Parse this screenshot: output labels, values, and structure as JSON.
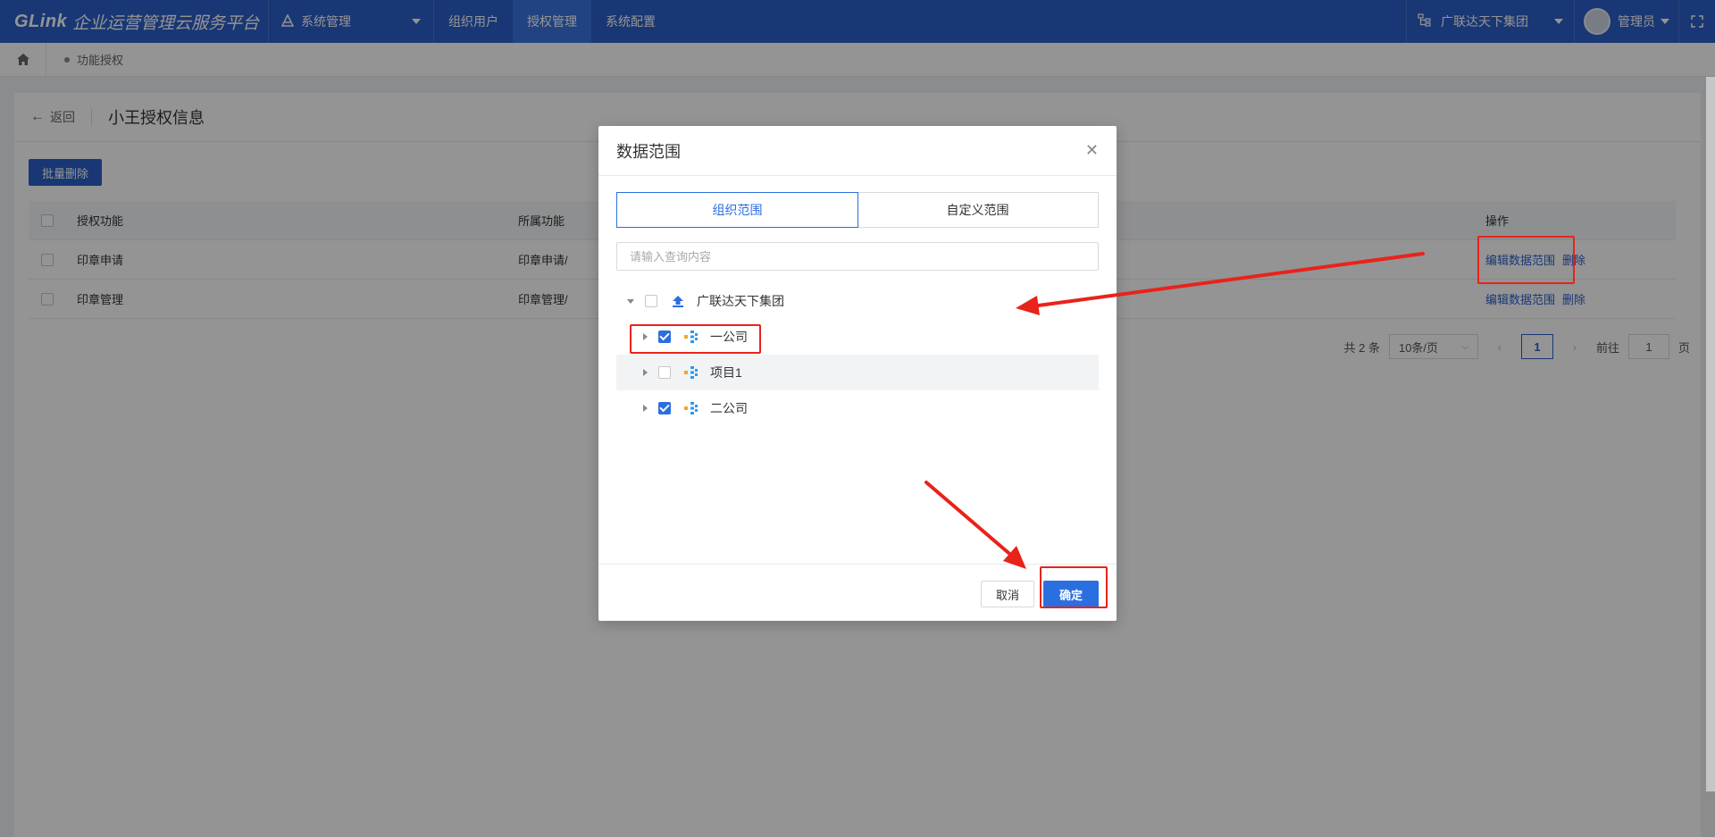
{
  "topbar": {
    "brand": "GLink",
    "platform_title": "企业运营管理云服务平台",
    "system_menu": "系统管理",
    "nav": [
      "组织用户",
      "授权管理",
      "系统配置"
    ],
    "active_nav": "授权管理",
    "org": "广联达天下集团",
    "user": "管理员"
  },
  "breadcrumb": {
    "current": "功能授权"
  },
  "page": {
    "back": "返回",
    "title": "小王授权信息",
    "batch_delete": "批量删除",
    "table": {
      "headers": [
        "授权功能",
        "所属功能",
        "操作"
      ],
      "rows": [
        {
          "func": "印章申请",
          "parent": "印章申请/",
          "edit": "编辑数据范围",
          "delete": "删除"
        },
        {
          "func": "印章管理",
          "parent": "印章管理/",
          "edit": "编辑数据范围",
          "delete": "删除"
        }
      ]
    },
    "pager": {
      "total": "共 2 条",
      "page_size": "10条/页",
      "current": "1",
      "goto_label": "前往",
      "goto_value": "1",
      "page_unit": "页"
    }
  },
  "modal": {
    "title": "数据范围",
    "tabs": [
      "组织范围",
      "自定义范围"
    ],
    "active_tab": "组织范围",
    "search_placeholder": "请输入查询内容",
    "tree": [
      {
        "label": "广联达天下集团",
        "level": 0,
        "expanded": true,
        "checked": false,
        "icon": "group-upload-icon"
      },
      {
        "label": "一公司",
        "level": 1,
        "expanded": false,
        "checked": true,
        "icon": "org-icon"
      },
      {
        "label": "项目1",
        "level": 1,
        "expanded": false,
        "checked": false,
        "icon": "org-icon"
      },
      {
        "label": "二公司",
        "level": 1,
        "expanded": false,
        "checked": true,
        "icon": "org-icon"
      }
    ],
    "cancel": "取消",
    "ok": "确定"
  },
  "colors": {
    "primary": "#2b6ee0",
    "topbar": "#2b5fc9",
    "annotation": "#e8231a"
  }
}
